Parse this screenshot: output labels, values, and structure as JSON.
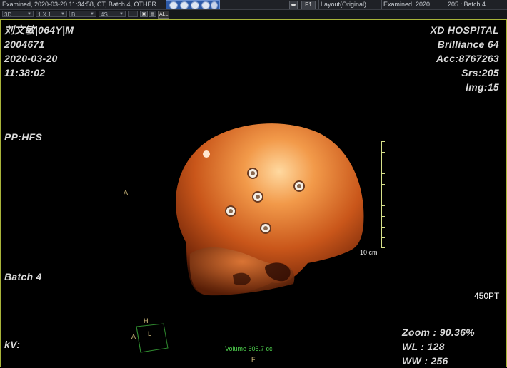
{
  "top": {
    "status_left": "Examined, 2020-03-20 11:34:58, CT, Batch 4, OTHER",
    "page_button": "P1",
    "tabs": [
      "Layout(Original)",
      "Examined, 2020...",
      "205 : Batch 4"
    ]
  },
  "toolbar": {
    "dd1": "3D",
    "dd2": "1 X 1",
    "dd3": "B",
    "dd4": "4S",
    "dd5": "...",
    "all_label": "ALL"
  },
  "patient": {
    "name_line": "刘文敏|064Y|M",
    "id": "2004671",
    "date": "2020-03-20",
    "time": "11:38:02"
  },
  "hospital": {
    "name": "XD  HOSPITAL",
    "scanner": "Brilliance 64",
    "acc": "Acc:8767263",
    "srs": "Srs:205",
    "img": "Img:15"
  },
  "position": "PP:HFS",
  "batch": "Batch 4",
  "kv": "kV:",
  "orientation": {
    "left": "A",
    "bottom": "F",
    "cube_top": "H",
    "cube_left": "A",
    "cube_front": "L"
  },
  "scale_label": "10 cm",
  "projection": "450PT",
  "volume": "Volume 605.7 cc",
  "window": {
    "zoom": "Zoom : 90.36%",
    "wl": "WL : 128",
    "ww": "WW : 256"
  }
}
